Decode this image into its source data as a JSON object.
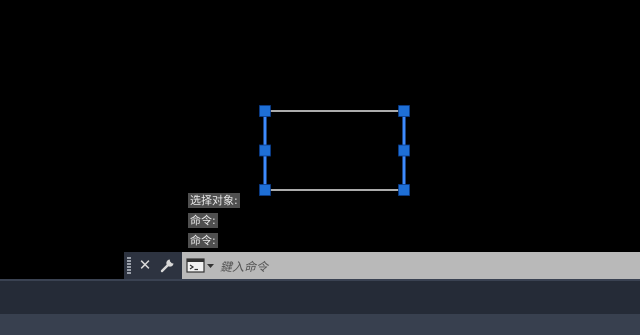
{
  "canvas": {
    "background": "#000000",
    "selected_object": "rectangle",
    "grip_color": "#1e6fd6"
  },
  "command_history": [
    "选择对象:",
    "命令:",
    "命令:"
  ],
  "command_line": {
    "input_value": "",
    "placeholder": "鍵入命令",
    "close_icon": "close-icon",
    "customize_icon": "wrench-icon",
    "prompt_icon": "terminal-prompt-icon"
  }
}
